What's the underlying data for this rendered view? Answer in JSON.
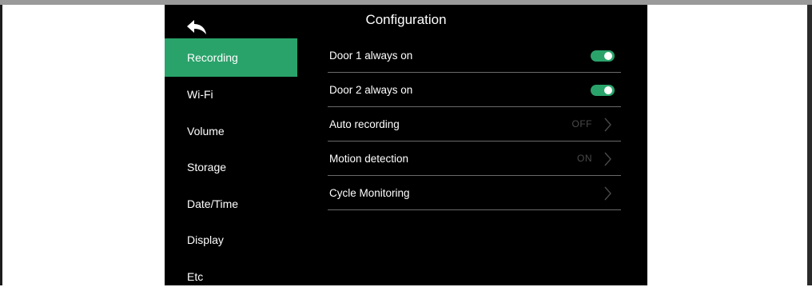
{
  "header": {
    "title": "Configuration",
    "back_icon": "back-arrow-icon"
  },
  "sidebar": {
    "items": [
      {
        "label": "Recording",
        "active": true
      },
      {
        "label": "Wi-Fi",
        "active": false
      },
      {
        "label": "Volume",
        "active": false
      },
      {
        "label": "Storage",
        "active": false
      },
      {
        "label": "Date/Time",
        "active": false
      },
      {
        "label": "Display",
        "active": false
      },
      {
        "label": "Etc",
        "active": false
      }
    ]
  },
  "settings": {
    "rows": [
      {
        "label": "Door 1 always on",
        "control": "toggle",
        "on": true
      },
      {
        "label": "Door 2 always on",
        "control": "toggle",
        "on": true
      },
      {
        "label": "Auto recording",
        "control": "chevron",
        "status": "OFF"
      },
      {
        "label": "Motion detection",
        "control": "chevron",
        "status": "ON"
      },
      {
        "label": "Cycle Monitoring",
        "control": "chevron",
        "status": ""
      }
    ]
  },
  "colors": {
    "accent": "#2aa36b",
    "background": "#000000",
    "status_text": "#4a4a4a",
    "divider": "#6a6a6a"
  }
}
